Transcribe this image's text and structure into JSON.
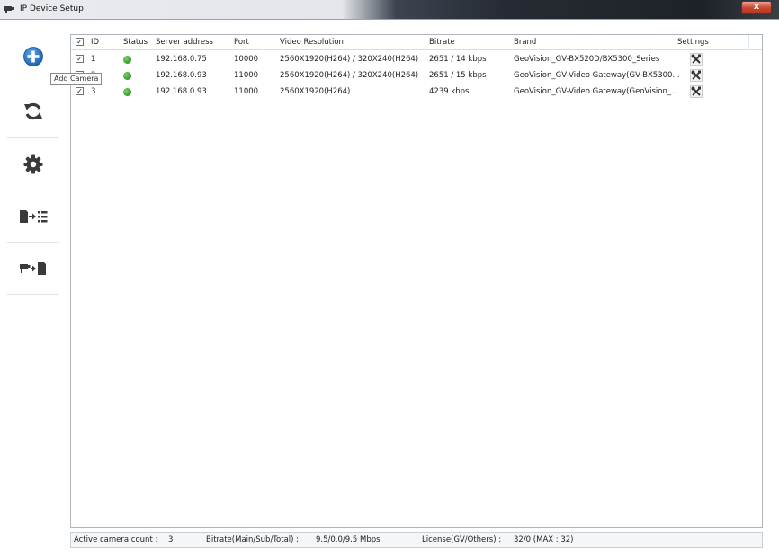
{
  "window": {
    "title": "IP Device Setup",
    "close_label": "x"
  },
  "sidebar": {
    "items": [
      {
        "name": "add-camera",
        "tooltip": "Add Camera"
      },
      {
        "name": "refresh"
      },
      {
        "name": "settings"
      },
      {
        "name": "export"
      },
      {
        "name": "import"
      }
    ]
  },
  "table": {
    "columns": [
      "ID",
      "Status",
      "Server address",
      "Port",
      "Video Resolution",
      "Bitrate",
      "Brand",
      "Settings"
    ],
    "rows": [
      {
        "checked": true,
        "id": "1",
        "status": "online",
        "server": "192.168.0.75",
        "port": "10000",
        "resolution": "2560X1920(H264) / 320X240(H264)",
        "bitrate": "2651 / 14 kbps",
        "brand": "GeoVision_GV-BX520D/BX5300_Series"
      },
      {
        "checked": true,
        "id": "2",
        "status": "online",
        "server": "192.168.0.93",
        "port": "11000",
        "resolution": "2560X1920(H264) / 320X240(H264)",
        "bitrate": "2651 / 15 kbps",
        "brand": "GeoVision_GV-Video Gateway(GV-BX5300..."
      },
      {
        "checked": true,
        "id": "3",
        "status": "online",
        "server": "192.168.0.93",
        "port": "11000",
        "resolution": "2560X1920(H264)",
        "bitrate": "4239 kbps",
        "brand": "GeoVision_GV-Video Gateway(GeoVision_..."
      }
    ]
  },
  "statusbar": {
    "active_label": "Active camera count :",
    "active_value": "3",
    "bitrate_label": "Bitrate(Main/Sub/Total) :",
    "bitrate_value": "9.5/0.0/9.5 Mbps",
    "license_label": "License(GV/Others) :",
    "license_value": "32/0 (MAX : 32)"
  },
  "colors": {
    "accent_blue": "#1f73c4",
    "status_green": "#2f9a24",
    "icon_gray": "#3a3a3a"
  }
}
